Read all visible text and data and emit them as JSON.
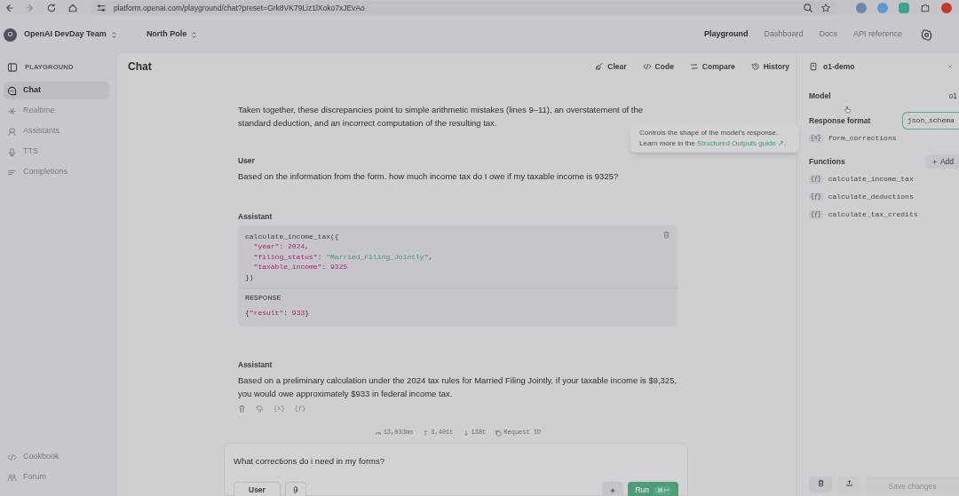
{
  "browser": {
    "url": "platform.openai.com/playground/chat?preset=Grk8VK79Liz1lXoko7xJEvAo"
  },
  "header": {
    "org_initial": "O",
    "org": "OpenAI DevDay Team",
    "project": "North Pole",
    "nav": [
      {
        "label": "Playground",
        "selected": true
      },
      {
        "label": "Dashboard",
        "selected": false
      },
      {
        "label": "Docs",
        "selected": false
      },
      {
        "label": "API reference",
        "selected": false
      }
    ]
  },
  "sidebar": {
    "heading": "PLAYGROUND",
    "items": [
      {
        "label": "Chat",
        "selected": true
      },
      {
        "label": "Realtime",
        "selected": false
      },
      {
        "label": "Assistants",
        "selected": false
      },
      {
        "label": "TTS",
        "selected": false
      },
      {
        "label": "Completions",
        "selected": false
      }
    ],
    "footer_items": [
      {
        "label": "Cookbook"
      },
      {
        "label": "Forum"
      }
    ]
  },
  "chat": {
    "title": "Chat",
    "toolbar": [
      {
        "label": "Clear"
      },
      {
        "label": "Code"
      },
      {
        "label": "Compare"
      },
      {
        "label": "History"
      }
    ],
    "messages": [
      {
        "kind": "text",
        "text": "Taken together, these discrepancies point to simple arithmetic mistakes (lines 9–11), an overstatement of the standard deduction, and an incorrect computation of the resulting tax."
      },
      {
        "kind": "text",
        "role": "User",
        "text": "Based on the information from the form. how much income tax do I owe if my taxable income is 9325?"
      },
      {
        "kind": "tool_call",
        "role": "Assistant",
        "code": [
          "calculate_income_tax({",
          "  \"year\": 2024,",
          "  \"filing_status\": \"Married_Filing_Jointly\",",
          "  \"taxable_income\": 9325",
          "})"
        ],
        "response_label": "RESPONSE",
        "response": [
          "{\"result\": 933}"
        ]
      },
      {
        "kind": "text",
        "role": "Assistant",
        "text": "Based on a preliminary calculation under the 2024 tax rules for Married Filing Jointly, if your taxable income is $9,325, you would owe approximately $933 in federal income tax.",
        "actions": [
          "{x}",
          "{ƒ}"
        ]
      }
    ],
    "stats": [
      "13,033ms",
      "3,401t",
      "138t",
      "Request ID"
    ],
    "composer": {
      "value": "What corrections do i need in my forms?",
      "role_button": "User",
      "run": "Run",
      "shortcut": "⌘↩"
    }
  },
  "tooltip": {
    "text": "Controls the shape of the model's response. Learn more in the",
    "link": "Structured Outputs guide ↗",
    "after": "."
  },
  "panel": {
    "title": "o1-demo",
    "model_label": "Model",
    "model": "o1",
    "format_label": "Response format",
    "format": "json_schema",
    "schema_icon": "{x}",
    "schema": "form_corrections",
    "functions_label": "Functions",
    "add": "Add",
    "functions": [
      {
        "icon": "{ƒ}",
        "name": "calculate_income_tax"
      },
      {
        "icon": "{ƒ}",
        "name": "calculate_deductions"
      },
      {
        "icon": "{ƒ}",
        "name": "calculate_tax_credits"
      }
    ],
    "save": "Save changes"
  }
}
